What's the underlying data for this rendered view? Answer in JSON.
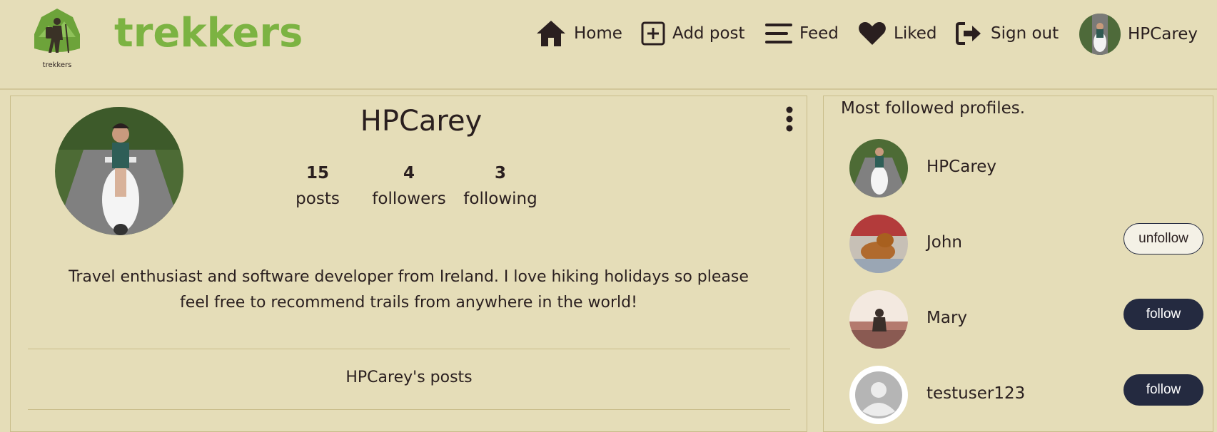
{
  "brand": {
    "name": "trekkers",
    "logo_caption": "trekkers",
    "color": "#7cb342"
  },
  "nav": {
    "home": "Home",
    "add_post": "Add post",
    "feed": "Feed",
    "liked": "Liked",
    "sign_out": "Sign out",
    "username": "HPCarey"
  },
  "profile": {
    "name": "HPCarey",
    "stats": [
      {
        "value": "15",
        "label": "posts"
      },
      {
        "value": "4",
        "label": "followers"
      },
      {
        "value": "3",
        "label": "following"
      }
    ],
    "bio": "Travel enthusiast and software developer from Ireland. I love hiking holidays so please feel free to recommend trails from anywhere in the world!",
    "posts_heading": "HPCarey's posts"
  },
  "sidebar": {
    "title": "Most followed profiles.",
    "profiles": [
      {
        "name": "HPCarey",
        "button": ""
      },
      {
        "name": "John",
        "button": "unfollow"
      },
      {
        "name": "Mary",
        "button": "follow"
      },
      {
        "name": "testuser123",
        "button": "follow"
      }
    ]
  },
  "colors": {
    "background": "#e5ddb8",
    "text": "#2a1f1f",
    "button_dark": "#242a40"
  }
}
